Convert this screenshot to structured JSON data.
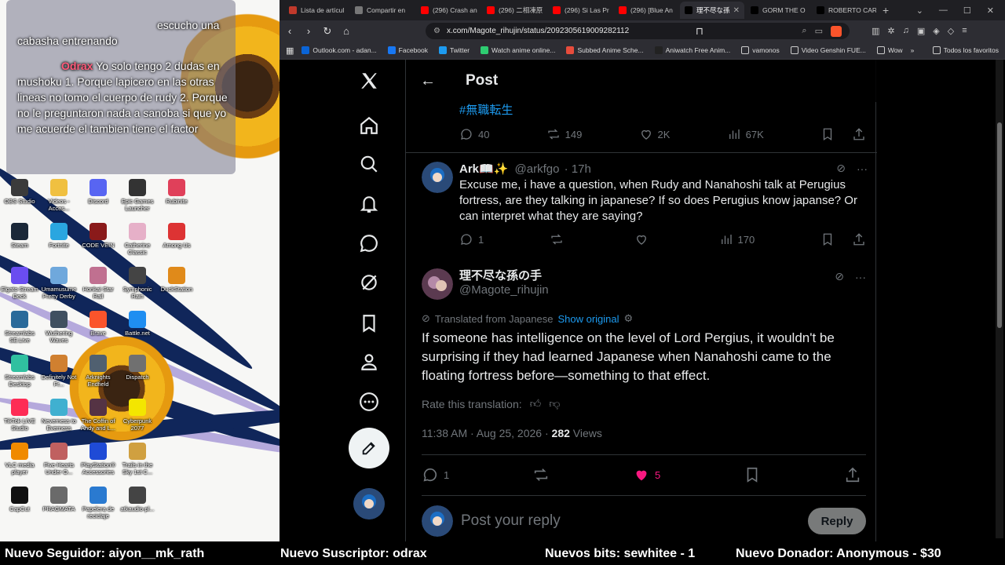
{
  "chat": {
    "lines": [
      {
        "user": "",
        "text": "escucho una cabasha entrenando"
      },
      {
        "user": "Odrax",
        "text": "Yo solo tengo 2 dudas en mushoku 1. Porque lapicero en las otras lineas no tomo el cuerpo de rudy 2. Porque no le preguntaron nada a sanoba si que yo me acuerde el tambien tiene el factor"
      }
    ]
  },
  "desktop_icons": [
    "OBS Studio",
    "Videos - Acces...",
    "Discord",
    "Epic Games Launcher",
    "Rubinite",
    "Steam",
    "Fortnite",
    "CODE VEIN",
    "Catherine Classic",
    "Among Us",
    "Elgato Stream Deck",
    "Umamusume Pretty Derby",
    "Honkai Star Rail",
    "Symphonic Rain",
    "DuckStation",
    "Streamlabs SE.Live",
    "Wuthering Waves",
    "Brave",
    "Battle.net",
    "Streamlabs Desktop",
    "Definitely Not Fr...",
    "Arknights Endfield",
    "Dispatch",
    "TikTok LIVE Studio",
    "Neverness to Everness",
    "The Coffin of Andy and L...",
    "Cyberpunk 2077",
    "VLC media player",
    "Five Hearts Under O...",
    "PlayStation® Accessories",
    "Trails in the Sky 1st C...",
    "CapCut",
    "PRAGMATA",
    "Papelera de reciclaje",
    "atkaudio-pl..."
  ],
  "browser": {
    "tabs": [
      {
        "label": "Lista de artícul",
        "color": "#c0392b"
      },
      {
        "label": "Compartir en",
        "color": "#777777"
      },
      {
        "label": "(296) Crash an",
        "color": "#ff0000"
      },
      {
        "label": "(296) 二相凍原",
        "color": "#ff0000"
      },
      {
        "label": "(296) Si Las Pr",
        "color": "#ff0000"
      },
      {
        "label": "(296) [Blue An",
        "color": "#ff0000"
      },
      {
        "label": "理不尽な孫",
        "color": "#000000",
        "active": true
      },
      {
        "label": "GORM THE O",
        "color": "#000000"
      },
      {
        "label": "ROBERTO CAR",
        "color": "#000000"
      }
    ],
    "url": "x.com/Magote_rihujin/status/2092305619009282112",
    "bookmarks": [
      {
        "label": "Outlook.com - adan...",
        "color": "#0a64d6"
      },
      {
        "label": "Facebook",
        "color": "#1877f2"
      },
      {
        "label": "Twitter",
        "color": "#1d9bf0"
      },
      {
        "label": "Watch anime online...",
        "color": "#2ecc71"
      },
      {
        "label": "Subbed Anime Sche...",
        "color": "#e74c3c"
      },
      {
        "label": "Aniwatch Free Anim...",
        "color": "#222222"
      },
      {
        "label": "vamonos",
        "color": "folder"
      },
      {
        "label": "Video Genshin FUE...",
        "color": "folder"
      },
      {
        "label": "Wow",
        "color": "folder"
      }
    ],
    "bookmarks_right": "Todos los favoritos"
  },
  "post": {
    "header_title": "Post",
    "parent": {
      "hashtag": "#無職転生",
      "replies": "40",
      "reposts": "149",
      "likes": "2K",
      "views": "67K"
    },
    "reply": {
      "name": "Ark📖✨",
      "handle": "@arkfgo",
      "time": "· 17h",
      "text": "Excuse me, i have a question, when Rudy and Nanahoshi talk at Perugius fortress, are they talking in japanese? If so does Perugius know japanse? Or can interpret what they are saying?",
      "replies": "1",
      "reposts": "",
      "likes": "",
      "views": "170"
    },
    "main": {
      "name": "理不尽な孫の手",
      "handle": "@Magote_rihujin",
      "translated_label": "Translated from Japanese",
      "show_original": "Show original",
      "text": "If someone has intelligence on the level of Lord Pergius, it wouldn't be surprising if they had learned Japanese when Nanahoshi came to the floating fortress before—something to that effect.",
      "rate_label": "Rate this translation:",
      "timestamp": "11:38 AM · Aug 25, 2026 ·",
      "views_count": "282",
      "views_label": "Views",
      "replies": "1",
      "likes": "5"
    },
    "reply_placeholder": "Post your reply",
    "reply_button": "Reply"
  },
  "alerts": [
    "Nuevo Seguidor: aiyon__mk_rath",
    "Nuevo Suscriptor: odrax",
    "Nuevos bits: sewhitee - 1",
    "Nuevo Donador: Anonymous - $30"
  ],
  "colors": {
    "x_blue": "#1d9bf0",
    "like_pink": "#f91880",
    "brave": "#fb542b"
  }
}
